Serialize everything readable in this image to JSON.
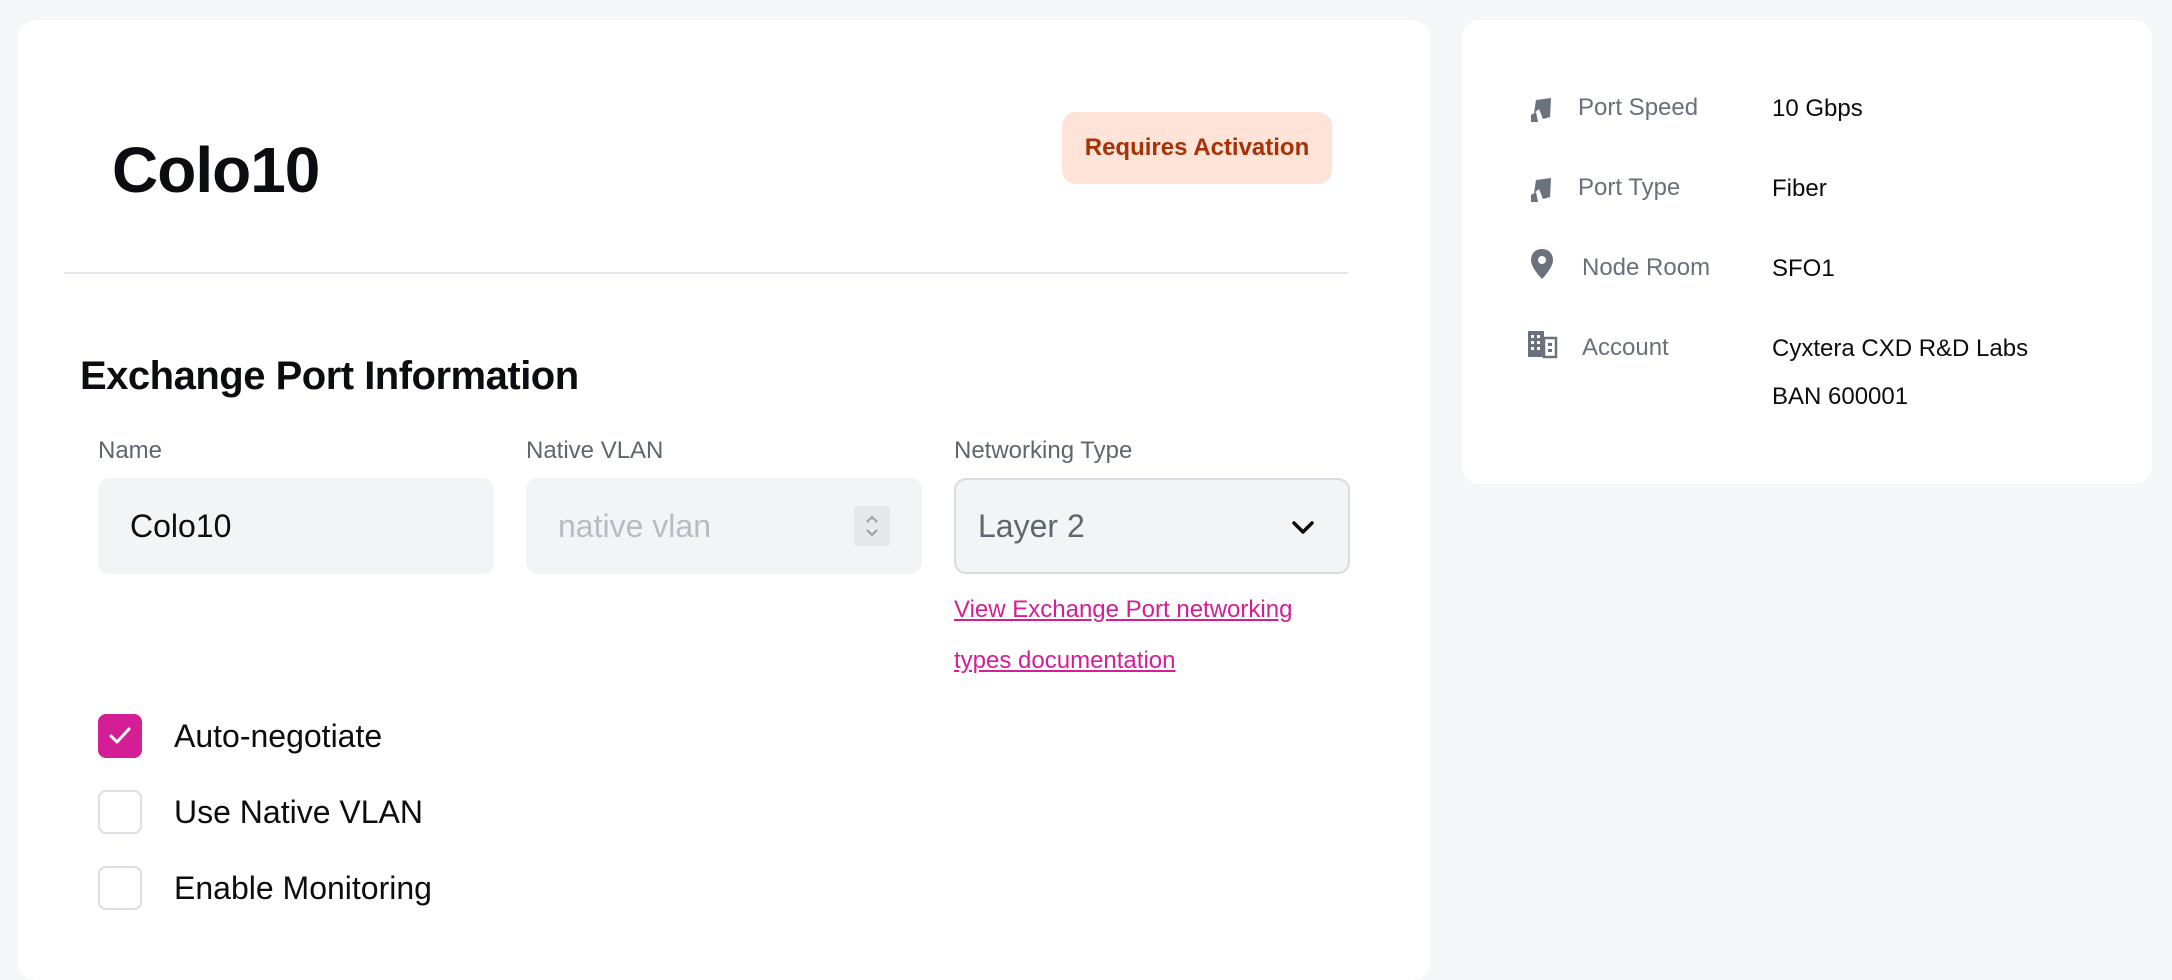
{
  "port": {
    "title": "Colo10",
    "status": "Requires Activation"
  },
  "section": {
    "title": "Exchange Port Information"
  },
  "fields": {
    "name_label": "Name",
    "name_value": "Colo10",
    "vlan_label": "Native VLAN",
    "vlan_placeholder": "native vlan",
    "networking_label": "Networking Type",
    "networking_value": "Layer 2",
    "doc_link_line1": "View Exchange Port networking",
    "doc_link_line2": "types documentation"
  },
  "options": [
    {
      "label": "Auto-negotiate",
      "checked": true
    },
    {
      "label": "Use Native VLAN",
      "checked": false
    },
    {
      "label": "Enable Monitoring",
      "checked": false
    }
  ],
  "details": {
    "port_speed_label": "Port Speed",
    "port_speed_value": "10 Gbps",
    "port_type_label": "Port Type",
    "port_type_value": "Fiber",
    "node_room_label": "Node Room",
    "node_room_value": "SFO1",
    "account_label": "Account",
    "account_value_line1": "Cyxtera CXD R&D Labs",
    "account_value_line2": "BAN 600001"
  },
  "icons": {
    "port_speed": "port-icon",
    "port_type": "port-icon",
    "node_room": "map-pin-icon",
    "account": "building-icon"
  },
  "colors": {
    "accent": "#d41e96",
    "badge_bg": "#fde3d8",
    "badge_text": "#a83207"
  }
}
